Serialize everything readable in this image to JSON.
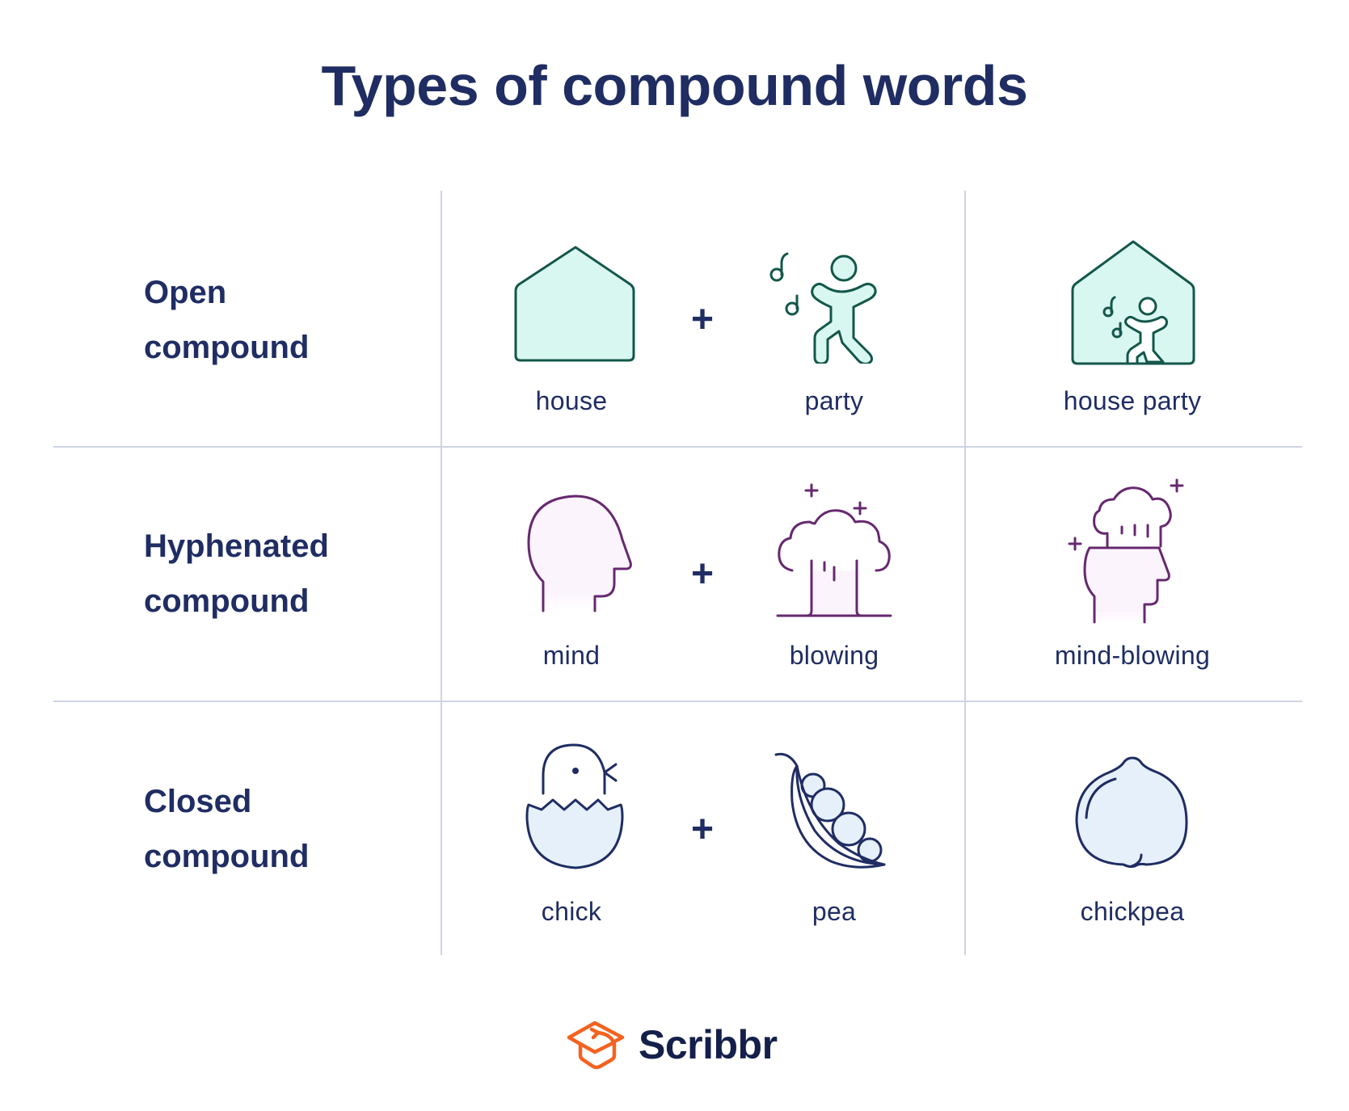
{
  "title": "Types of compound words",
  "colors": {
    "text": "#1f2d63",
    "grid": "#cdd3e2",
    "open_stroke": "#13574a",
    "open_fill": "#d9f7f1",
    "hyphen_stroke": "#66296f",
    "hyphen_fill": "#fcf4fd",
    "closed_stroke": "#1f2d63",
    "closed_fill": "#e6f0fb",
    "logo_orange": "#f4621f"
  },
  "rows": [
    {
      "label_line1": "Open",
      "label_line2": "compound",
      "first": {
        "word": "house",
        "icon": "house-icon"
      },
      "operator": "+",
      "second": {
        "word": "party",
        "icon": "dancing-person-icon"
      },
      "result": {
        "word": "house party",
        "icon": "house-party-icon"
      }
    },
    {
      "label_line1": "Hyphenated",
      "label_line2": "compound",
      "first": {
        "word": "mind",
        "icon": "head-profile-icon"
      },
      "operator": "+",
      "second": {
        "word": "blowing",
        "icon": "explosion-icon"
      },
      "result": {
        "word": "mind-blowing",
        "icon": "mind-blowing-icon"
      }
    },
    {
      "label_line1": "Closed",
      "label_line2": "compound",
      "first": {
        "word": "chick",
        "icon": "hatching-chick-icon"
      },
      "operator": "+",
      "second": {
        "word": "pea",
        "icon": "pea-pod-icon"
      },
      "result": {
        "word": "chickpea",
        "icon": "chickpea-icon"
      }
    }
  ],
  "logo": {
    "text": "Scribbr",
    "icon": "graduation-cap-icon"
  }
}
